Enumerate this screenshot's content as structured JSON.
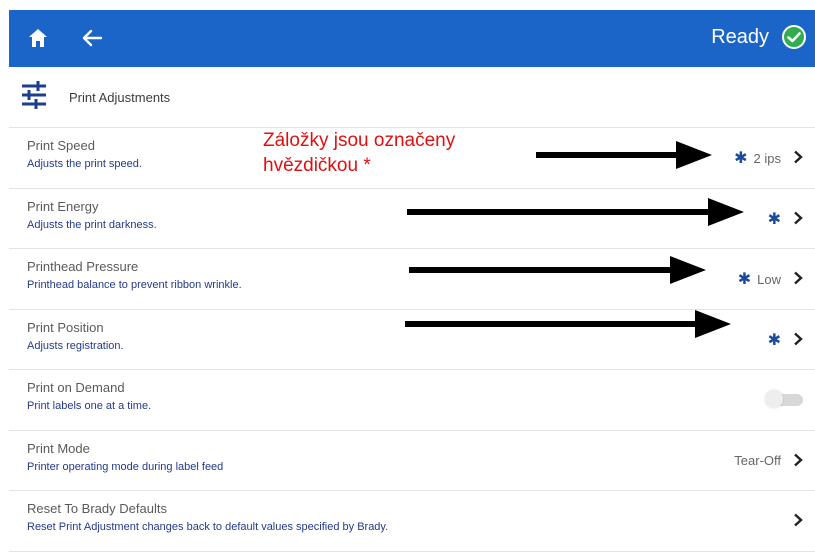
{
  "topbar": {
    "status": "Ready",
    "icons": [
      "home-icon",
      "back-arrow-icon",
      "ready-check-icon"
    ],
    "color": "#1b64c8"
  },
  "section": {
    "title": "Print Adjustments",
    "icon": "sliders-icon"
  },
  "items": [
    {
      "label": "Print Speed",
      "desc": "Adjusts the print speed.",
      "star": "✱",
      "value": "2 ips",
      "control": "chevron"
    },
    {
      "label": "Print Energy",
      "desc": "Adjusts the print darkness.",
      "star": "✱",
      "value": "",
      "control": "chevron"
    },
    {
      "label": "Printhead Pressure",
      "desc": "Printhead balance to prevent ribbon wrinkle.",
      "star": "✱",
      "value": "Low",
      "control": "chevron"
    },
    {
      "label": "Print Position",
      "desc": "Adjusts registration.",
      "star": "✱",
      "value": "",
      "control": "chevron"
    },
    {
      "label": "Print on Demand",
      "desc": "Print labels one at a time.",
      "star": "",
      "value": "",
      "control": "toggle",
      "toggle_on": false
    },
    {
      "label": "Print Mode",
      "desc": "Printer operating mode during label feed",
      "star": "",
      "value": "Tear-Off",
      "control": "chevron"
    },
    {
      "label": "Reset To Brady Defaults",
      "desc": "Reset Print Adjustment changes back to default values specified by Brady.",
      "star": "",
      "value": "",
      "control": "chevron"
    }
  ],
  "annotation": {
    "line1": "Záložky jsou označeny",
    "line2": "hvězdičkou *",
    "color": "#e01010"
  }
}
